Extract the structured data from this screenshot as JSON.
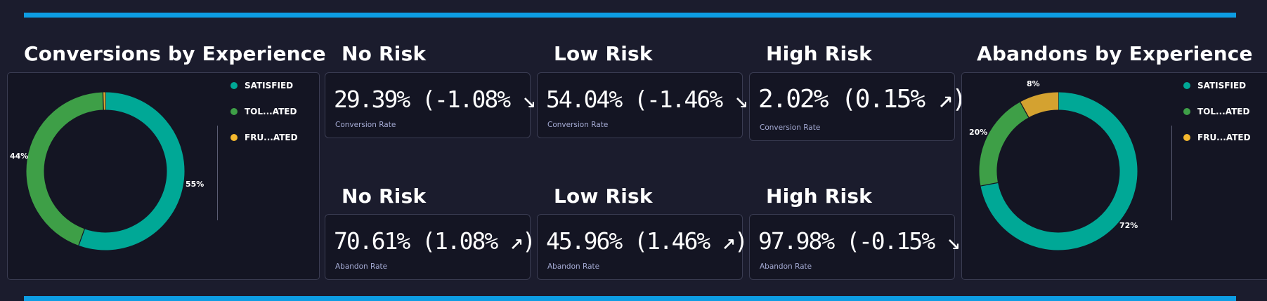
{
  "conversions": {
    "title": "Conversions by Experience",
    "legend": [
      {
        "label": "SATISFIED",
        "color": "#00a896"
      },
      {
        "label": "TOL...ATED",
        "color": "#3e9f47"
      },
      {
        "label": "FRU...ATED",
        "color": "#f5b82e"
      }
    ],
    "slice_labels": {
      "satisfied": "55%",
      "tolerated": "44%"
    }
  },
  "abandons": {
    "title": "Abandons by Experience",
    "legend": [
      {
        "label": "SATISFIED",
        "color": "#00a896"
      },
      {
        "label": "TOL...ATED",
        "color": "#3e9f47"
      },
      {
        "label": "FRU...ATED",
        "color": "#f5b82e"
      }
    ],
    "slice_labels": {
      "satisfied": "72%",
      "tolerated": "20%",
      "frustrated": "8%"
    }
  },
  "chart_data": [
    {
      "type": "pie",
      "title": "Conversions by Experience",
      "categories": [
        "SATISFIED",
        "TOL...ATED",
        "FRU...ATED"
      ],
      "values": [
        55.5,
        44,
        0.5
      ],
      "colors": [
        "#00a896",
        "#3e9f47",
        "#d4a230"
      ]
    },
    {
      "type": "pie",
      "title": "Abandons by Experience",
      "categories": [
        "SATISFIED",
        "TOL...ATED",
        "FRU...ATED"
      ],
      "values": [
        72,
        20,
        8
      ],
      "colors": [
        "#00a896",
        "#3e9f47",
        "#d4a230"
      ]
    }
  ],
  "risk_headers": {
    "row1": [
      "No Risk",
      "Low Risk",
      "High Risk"
    ],
    "row2": [
      "No Risk",
      "Low Risk",
      "High Risk"
    ]
  },
  "cards": {
    "row1": [
      {
        "value": "29.39% (-1.08% ↘)",
        "label": "Conversion Rate"
      },
      {
        "value": "54.04% (-1.46% ↘)",
        "label": "Conversion Rate"
      },
      {
        "value": "2.02% (0.15% ↗)",
        "label": "Conversion Rate"
      }
    ],
    "row2": [
      {
        "value": "70.61% (1.08% ↗)",
        "label": "Abandon Rate"
      },
      {
        "value": "45.96% (1.46% ↗)",
        "label": "Abandon Rate"
      },
      {
        "value": "97.98% (-0.15% ↘)",
        "label": "Abandon Rate"
      }
    ]
  }
}
